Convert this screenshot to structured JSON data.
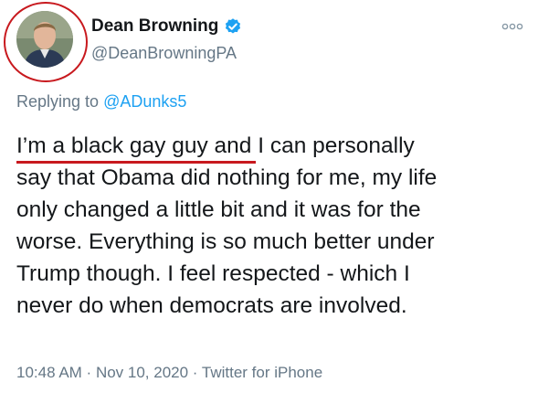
{
  "user": {
    "display_name": "Dean Browning",
    "handle": "@DeanBrowningPA"
  },
  "reply": {
    "prefix": "Replying to ",
    "to": "@ADunks5"
  },
  "tweet": {
    "text": "I’m a black gay guy and I can personally\nsay that Obama did nothing for me, my life\nonly changed a little bit and it was for the\nworse. Everything is so much better under\nTrump though. I feel respected - which I\nnever do when democrats are involved."
  },
  "meta": {
    "time": "10:48 AM",
    "date": "Nov 10, 2020",
    "source": "Twitter for iPhone",
    "separator": " · "
  },
  "colors": {
    "text": "#14171a",
    "secondary": "#657786",
    "link": "#1da1f2",
    "verified": "#1da1f2",
    "highlight_red": "#c8191e"
  },
  "icons": {
    "verified": "verified-badge-icon",
    "more": "more-options-icon"
  }
}
